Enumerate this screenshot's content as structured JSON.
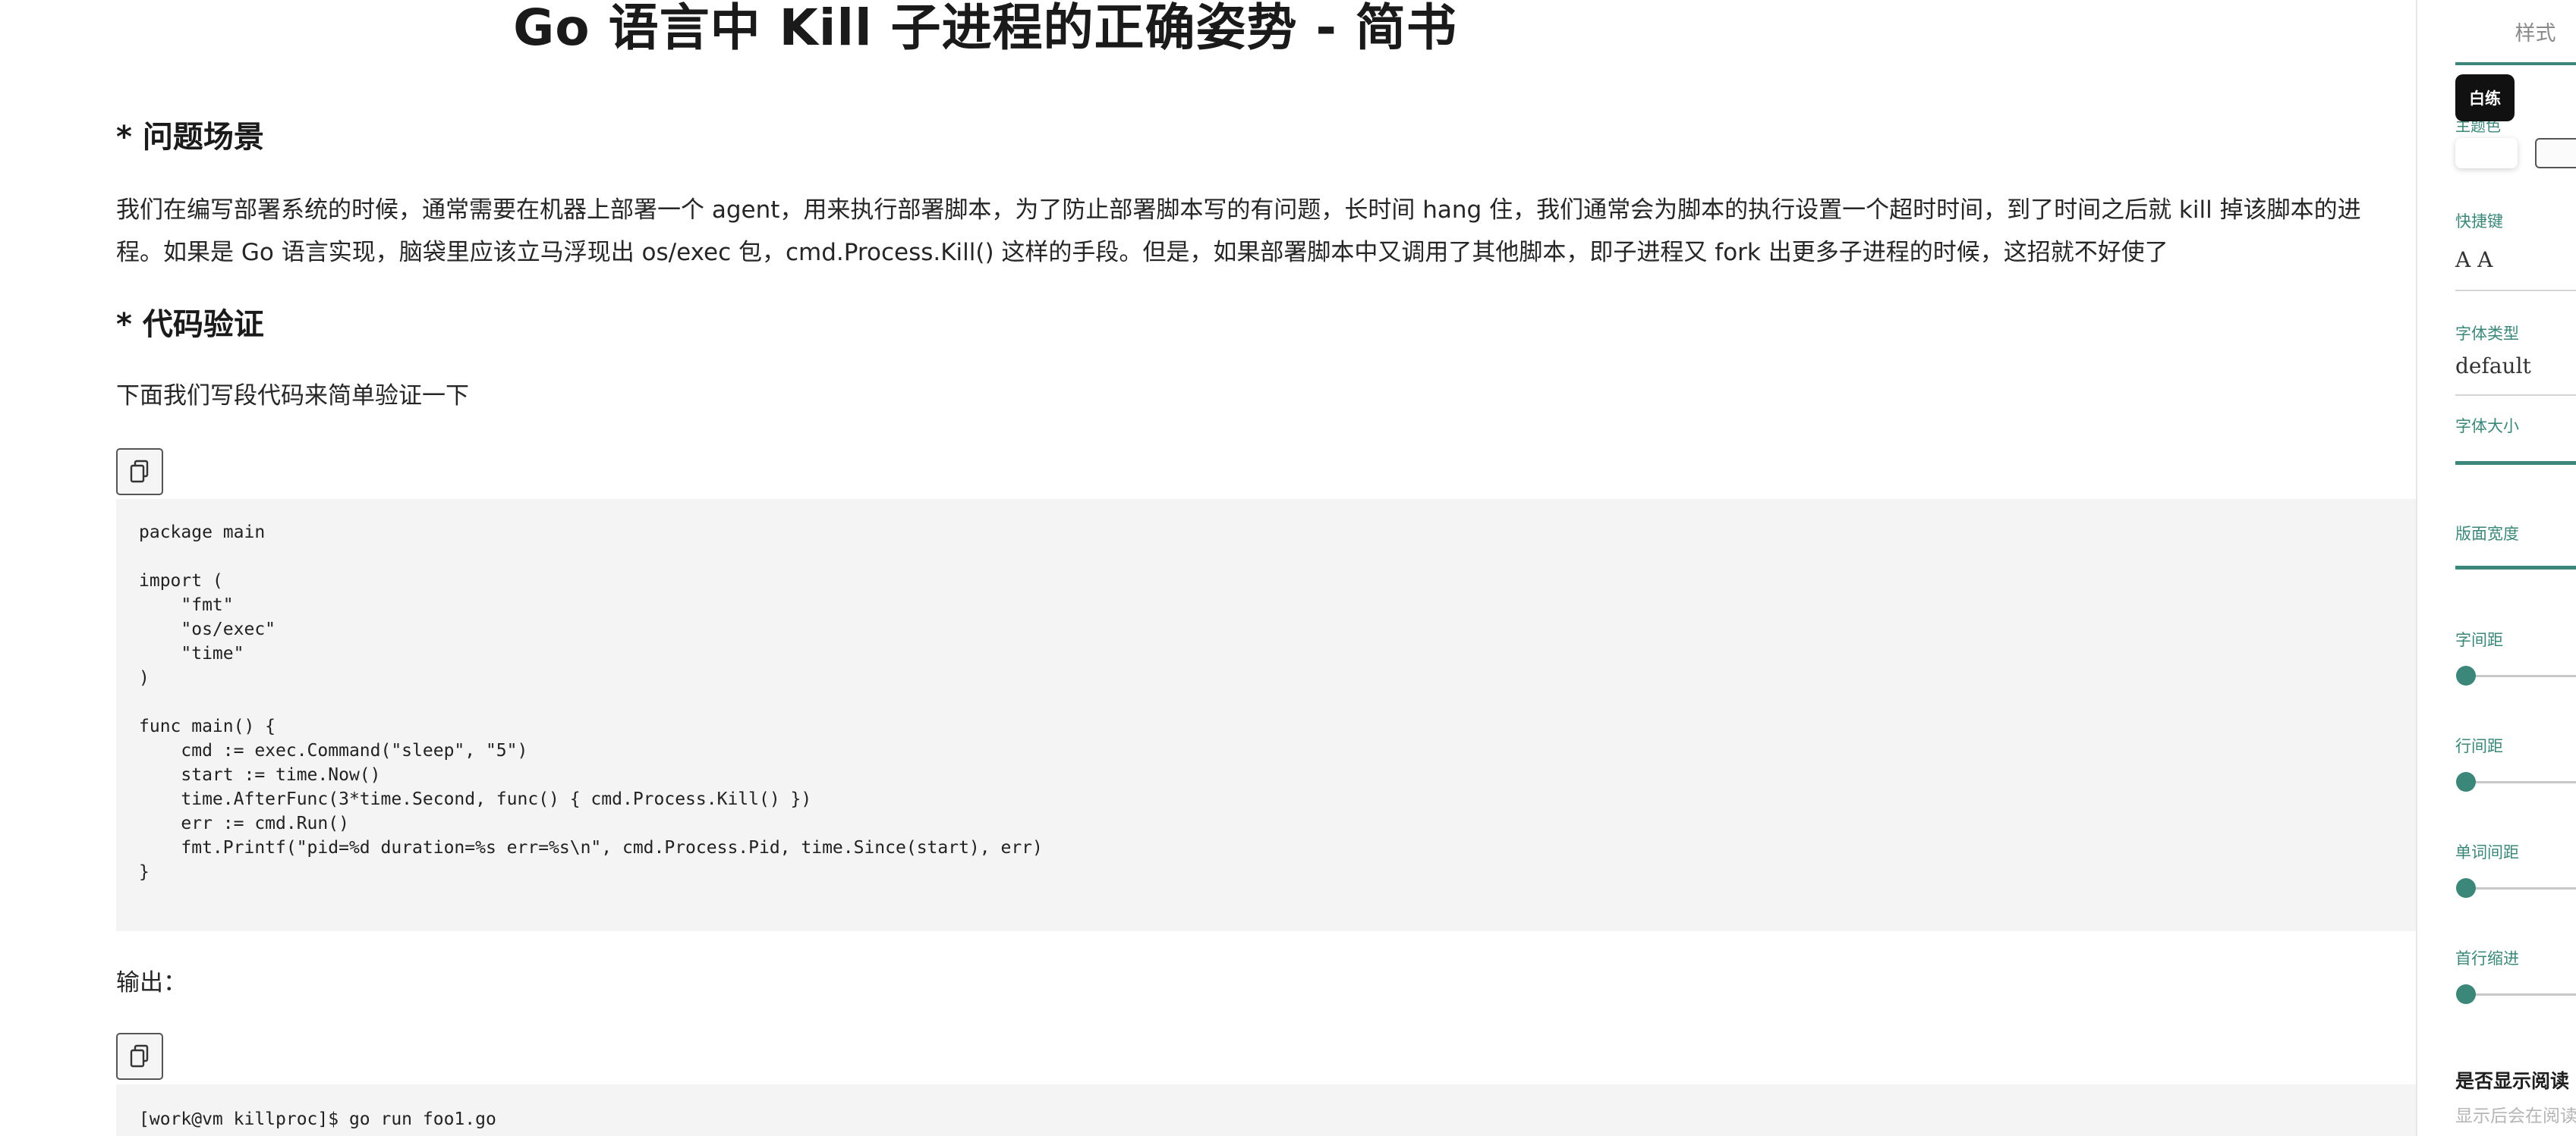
{
  "article": {
    "title": "Go 语言中 Kill 子进程的正确姿势 - 简书",
    "section1_heading": "* 问题场景",
    "section1_para_line1": "我们在编写部署系统的时候，通常需要在机器上部署一个 agent，用来执行部署脚本，为了防止部署脚本写的有问题，长时间 hang 住，我们通常会为脚本的执行设置一个超时时间，到了时间之后就 kill 掉该脚本的进",
    "section1_para_line2": "程。如果是 Go 语言实现，脑袋里应该立马浮现出 os/exec 包，cmd.Process.Kill() 这样的手段。但是，如果部署脚本中又调用了其他脚本，即子进程又 fork 出更多子进程的时候，这招就不好使了",
    "section2_heading": "* 代码验证",
    "section2_para": "下面我们写段代码来简单验证一下",
    "code1_lines": [
      "package main",
      "",
      "import (",
      "    \"fmt\"",
      "    \"os/exec\"",
      "    \"time\"",
      ")",
      "",
      "func main() {",
      "    cmd := exec.Command(\"sleep\", \"5\")",
      "    start := time.Now()",
      "    time.AfterFunc(3*time.Second, func() { cmd.Process.Kill() })",
      "    err := cmd.Run()",
      "    fmt.Printf(\"pid=%d duration=%s err=%s\\n\", cmd.Process.Pid, time.Since(start), err)",
      "}"
    ],
    "output_label": "输出：",
    "code2_lines": [
      "[work@vm killproc]$ go run foo1.go"
    ]
  },
  "panel": {
    "tab_label": "样式",
    "tooltip": "白练",
    "tooltip_under": "主题色",
    "shortcut_label": "快捷键",
    "shortcut_value": "A A",
    "font_type_label": "字体类型",
    "font_type_value": "default",
    "font_size_label": "字体大小",
    "page_width_label": "版面宽度",
    "letter_spacing_label": "字间距",
    "letter_spacing_level": 0,
    "line_spacing_label": "行间距",
    "line_spacing_level": 0,
    "word_spacing_label": "单词间距",
    "word_spacing_level": 0,
    "indent_label": "首行缩进",
    "indent_level": 0,
    "show_reading_label": "是否显示阅读",
    "show_reading_hint": "显示后会在阅读"
  },
  "colors": {
    "accent": "#3b8779",
    "code_bg": "#f4f4f4"
  }
}
